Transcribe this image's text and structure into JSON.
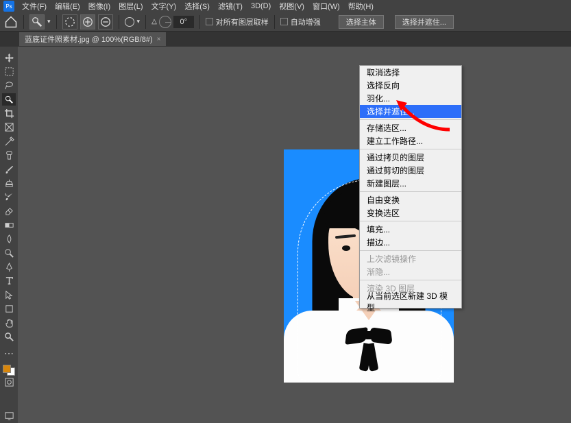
{
  "menu": {
    "file": "文件(F)",
    "edit": "编辑(E)",
    "image": "图像(I)",
    "layer": "图层(L)",
    "type": "文字(Y)",
    "select": "选择(S)",
    "filter": "滤镜(T)",
    "threed": "3D(D)",
    "view": "视图(V)",
    "window": "窗口(W)",
    "help": "帮助(H)"
  },
  "options": {
    "angle_value": "0°",
    "sample_all": "对所有图层取样",
    "auto_enhance": "自动增强",
    "select_subject": "选择主体",
    "select_and_mask": "选择并遮住..."
  },
  "tab": {
    "title": "蓝底证件照素材.jpg @ 100%(RGB/8#)",
    "close": "×"
  },
  "context_menu": {
    "deselect": "取消选择",
    "inverse": "选择反向",
    "feather": "羽化...",
    "select_and_mask": "选择并遮住...",
    "save_selection": "存储选区...",
    "make_work_path": "建立工作路径...",
    "layer_via_copy": "通过拷贝的图层",
    "layer_via_cut": "通过剪切的图层",
    "new_layer": "新建图层...",
    "free_transform": "自由变换",
    "transform_selection": "变换选区",
    "fill": "填充...",
    "stroke": "描边...",
    "last_filter": "上次滤镜操作",
    "fade": "渐隐...",
    "render_3d": "渲染 3D 图层",
    "new_3d": "从当前选区新建 3D 模型"
  },
  "tools": {
    "move": "move-tool",
    "marquee-rect": "rect-marquee",
    "marquee-ellipse": "ellipse-marquee",
    "lasso": "lasso",
    "quickselect": "quick-selection",
    "crop": "crop",
    "frame": "frame",
    "eyedropper": "eyedropper",
    "healing": "healing-brush",
    "brush": "brush",
    "stamp": "clone-stamp",
    "history": "history-brush",
    "eraser": "eraser",
    "gradient": "gradient",
    "blur": "blur",
    "dodge": "dodge",
    "pen": "pen",
    "type": "type",
    "path": "path-select",
    "shape": "shape",
    "hand": "hand",
    "zoom": "zoom"
  }
}
